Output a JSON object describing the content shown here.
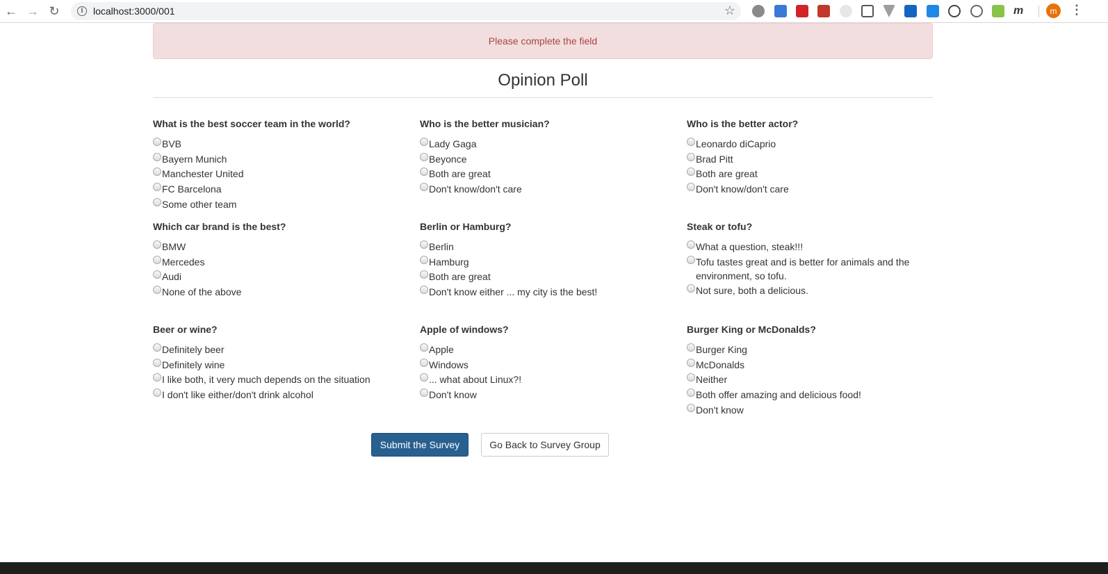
{
  "browser": {
    "url": "localhost:3000/001",
    "profile_initial": "m"
  },
  "alert": {
    "message": "Please complete the field"
  },
  "page": {
    "title": "Opinion Poll"
  },
  "questions": [
    {
      "title": "What is the best soccer team in the world?",
      "options": [
        "BVB",
        "Bayern Munich",
        "Manchester United",
        "FC Barcelona",
        "Some other team"
      ]
    },
    {
      "title": "Who is the better musician?",
      "options": [
        "Lady Gaga",
        "Beyonce",
        "Both are great",
        "Don't know/don't care"
      ]
    },
    {
      "title": "Who is the better actor?",
      "options": [
        "Leonardo diCaprio",
        "Brad Pitt",
        "Both are great",
        "Don't know/don't care"
      ]
    },
    {
      "title": "Which car brand is the best?",
      "options": [
        "BMW",
        "Mercedes",
        "Audi",
        "None of the above"
      ]
    },
    {
      "title": "Berlin or Hamburg?",
      "options": [
        "Berlin",
        "Hamburg",
        "Both are great",
        "Don't know either ... my city is the best!"
      ]
    },
    {
      "title": "Steak or tofu?",
      "options": [
        "What a question, steak!!!",
        "Tofu tastes great and is better for animals and the environment, so tofu.",
        "Not sure, both a delicious."
      ]
    },
    {
      "title": "Beer or wine?",
      "options": [
        "Definitely beer",
        "Definitely wine",
        "I like both, it very much depends on the situation",
        "I don't like either/don't drink alcohol"
      ]
    },
    {
      "title": "Apple of windows?",
      "options": [
        "Apple",
        "Windows",
        "... what about Linux?!",
        "Don't know"
      ]
    },
    {
      "title": "Burger King or McDonalds?",
      "options": [
        "Burger King",
        "McDonalds",
        "Neither",
        "Both offer amazing and delicious food!",
        "Don't know"
      ]
    }
  ],
  "buttons": {
    "submit": "Submit the Survey",
    "back": "Go Back to Survey Group"
  },
  "colors": {
    "alert_bg": "#f2dede",
    "alert_text": "#a94442",
    "primary": "#286090"
  }
}
